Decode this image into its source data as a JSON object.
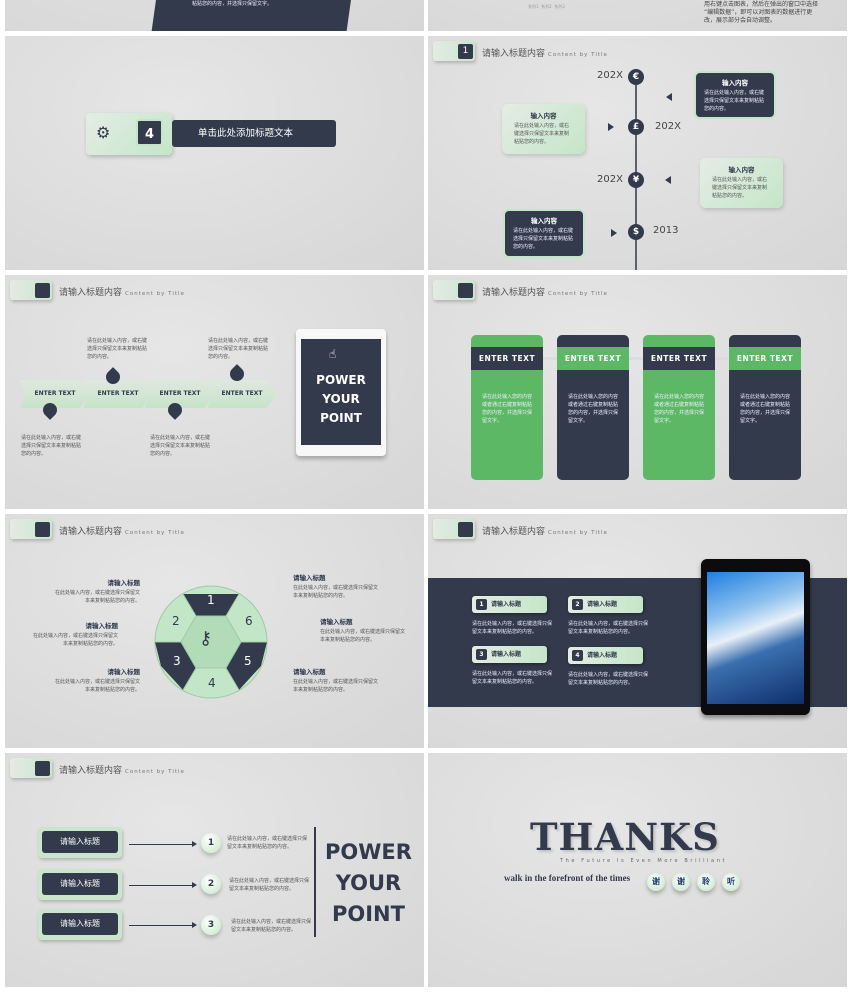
{
  "colors": {
    "dark": "#323a4c",
    "green": "#5cb865",
    "mint": "#c4e6c8"
  },
  "header": {
    "title": "请输入标题内容",
    "subtitle": "Content by Title"
  },
  "top_partial": {
    "left_text": "粘贴您的内容，并选择只保留文字。",
    "legend": [
      "系列1",
      "系列2",
      "系列3"
    ],
    "right_lines": [
      "用右键点击图表，然后在弹出的窗口中选择",
      "“编辑数据”，即可以对图表的数据进行更",
      "改，展示部分会自动调整。"
    ]
  },
  "section": {
    "number": "4",
    "title": "单击此处添加标题文本",
    "icon": "gears-icon"
  },
  "timeline": {
    "header_num": "1",
    "items": [
      {
        "year": "202X",
        "symbol": "€",
        "box_title": "输入内容",
        "box_text": "请在此处输入内容，或右键选择只保留文本来复制粘贴您的内容。"
      },
      {
        "year": "202X",
        "symbol": "£",
        "box_title": "输入内容",
        "box_text": "请在此处输入内容，或右键选择只保留文本来复制粘贴您的内容。"
      },
      {
        "year": "202X",
        "symbol": "¥",
        "box_title": "输入内容",
        "box_text": "请在此处输入内容，或右键选择只保留文本来复制粘贴您的内容。"
      },
      {
        "year": "2013",
        "symbol": "$",
        "box_title": "输入内容",
        "box_text": "请在此处输入内容，或右键选择只保留文本来复制粘贴您的内容。"
      }
    ]
  },
  "process": {
    "steps": [
      "ENTER TEXT",
      "ENTER TEXT",
      "ENTER TEXT",
      "ENTER TEXT"
    ],
    "text": "请在此处输入内容，或右键选择只保留文本来复制粘贴您的内容。",
    "tablet_lines": [
      "POWER",
      "YOUR",
      "POINT"
    ]
  },
  "cards": {
    "items": [
      {
        "label": "ENTER  TEXT",
        "text": "请在此处输入您的内容或者通过右键复制粘贴您的内容，并选择只保留文字。"
      },
      {
        "label": "ENTER  TEXT",
        "text": "请在此处输入您的内容或者通过右键复制粘贴您的内容，并选择只保留文字。"
      },
      {
        "label": "ENTER  TEXT",
        "text": "请在此处输入您的内容或者通过右键复制粘贴您的内容，并选择只保留文字。"
      },
      {
        "label": "ENTER  TEXT",
        "text": "请在此处输入您的内容或者通过右键复制粘贴您的内容，并选择只保留文字。"
      }
    ]
  },
  "wheel": {
    "numbers": [
      "1",
      "2",
      "3",
      "4",
      "5",
      "6"
    ],
    "blocks": [
      {
        "title": "请输入标题",
        "text": "在此处输入内容，或右键选择只保留文本来复制粘贴您的内容。"
      },
      {
        "title": "请输入标题",
        "text": "在此处输入内容，或右键选择只保留文本来复制粘贴您的内容。"
      },
      {
        "title": "请输入标题",
        "text": "在此处输入内容，或右键选择只保留文本来复制粘贴您的内容。"
      },
      {
        "title": "请输入标题",
        "text": "在此处输入内容，或右键选择只保留文本来复制粘贴您的内容。"
      },
      {
        "title": "请输入标题",
        "text": "在此处输入内容，或右键选择只保留文本来复制粘贴您的内容。"
      },
      {
        "title": "请输入标题",
        "text": "在此处输入内容，或右键选择只保留文本来复制粘贴您的内容。"
      }
    ]
  },
  "band": {
    "items": [
      {
        "num": "1",
        "title": "请输入标题",
        "text": "请在此处输入内容，或右键选择只保留文本来复制粘贴您的内容。"
      },
      {
        "num": "2",
        "title": "请输入标题",
        "text": "请在此处输入内容，或右键选择只保留文本来复制粘贴您的内容。"
      },
      {
        "num": "3",
        "title": "请输入标题",
        "text": "请在此处输入内容，或右键选择只保留文本来复制粘贴您的内容。"
      },
      {
        "num": "4",
        "title": "请输入标题",
        "text": "请在此处输入内容，或右键选择只保留文本来复制粘贴您的内容。"
      }
    ]
  },
  "list": {
    "items": [
      {
        "label": "请输入标题",
        "num": "1",
        "text": "请在此处输入内容，或右键选择只保留文本来复制粘贴您的内容。"
      },
      {
        "label": "请输入标题",
        "num": "2",
        "text": "请在此处输入内容，或右键选择只保留文本来复制粘贴您的内容。"
      },
      {
        "label": "请输入标题",
        "num": "3",
        "text": "请在此处输入内容，或右键选择只保留文本来复制粘贴您的内容。"
      }
    ],
    "big": [
      "POWER",
      "YOUR",
      "POINT"
    ]
  },
  "thanks": {
    "word": "THANKS",
    "tagline": "The Future Is Even More Brilliant",
    "motto": "walk in the forefront of the times",
    "chars": [
      "谢",
      "谢",
      "聆",
      "听"
    ]
  }
}
